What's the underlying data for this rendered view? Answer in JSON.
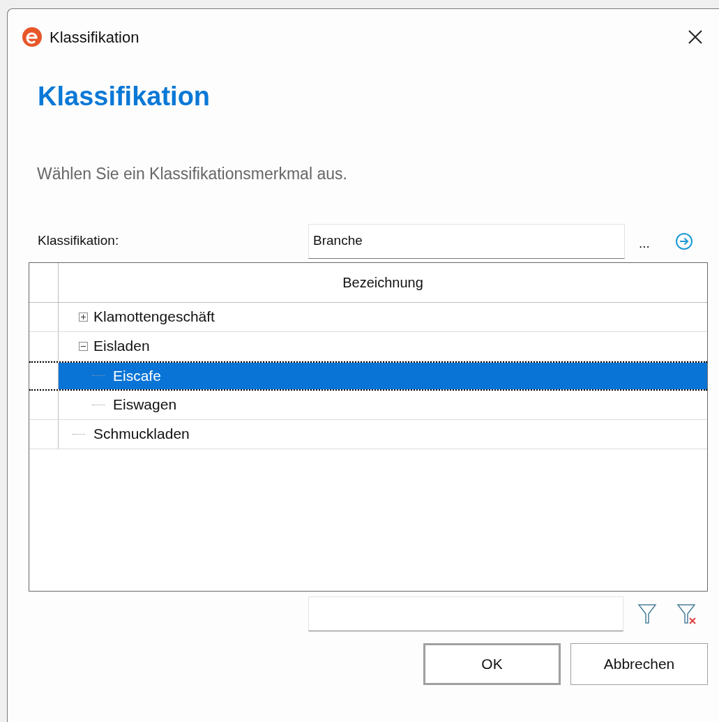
{
  "window": {
    "title": "Klassifikation"
  },
  "heading": "Klassifikation",
  "instruction": "Wählen Sie ein Klassifikationsmerkmal aus.",
  "classification": {
    "label": "Klassifikation:",
    "value": "Branche",
    "browse": "..."
  },
  "grid": {
    "columns": [
      "Bezeichnung"
    ],
    "rows": [
      {
        "label": "Klamottengeschäft",
        "expanded": false,
        "selected": false,
        "children": []
      },
      {
        "label": "Eisladen",
        "expanded": true,
        "selected": false,
        "children": [
          {
            "label": "Eiscafe",
            "selected": true
          },
          {
            "label": "Eiswagen",
            "selected": false
          }
        ]
      },
      {
        "label": "Schmuckladen",
        "selected": false
      }
    ]
  },
  "buttons": [
    {
      "label": "OK",
      "default": true
    },
    {
      "label": "Abbrechen",
      "default": false
    }
  ]
}
